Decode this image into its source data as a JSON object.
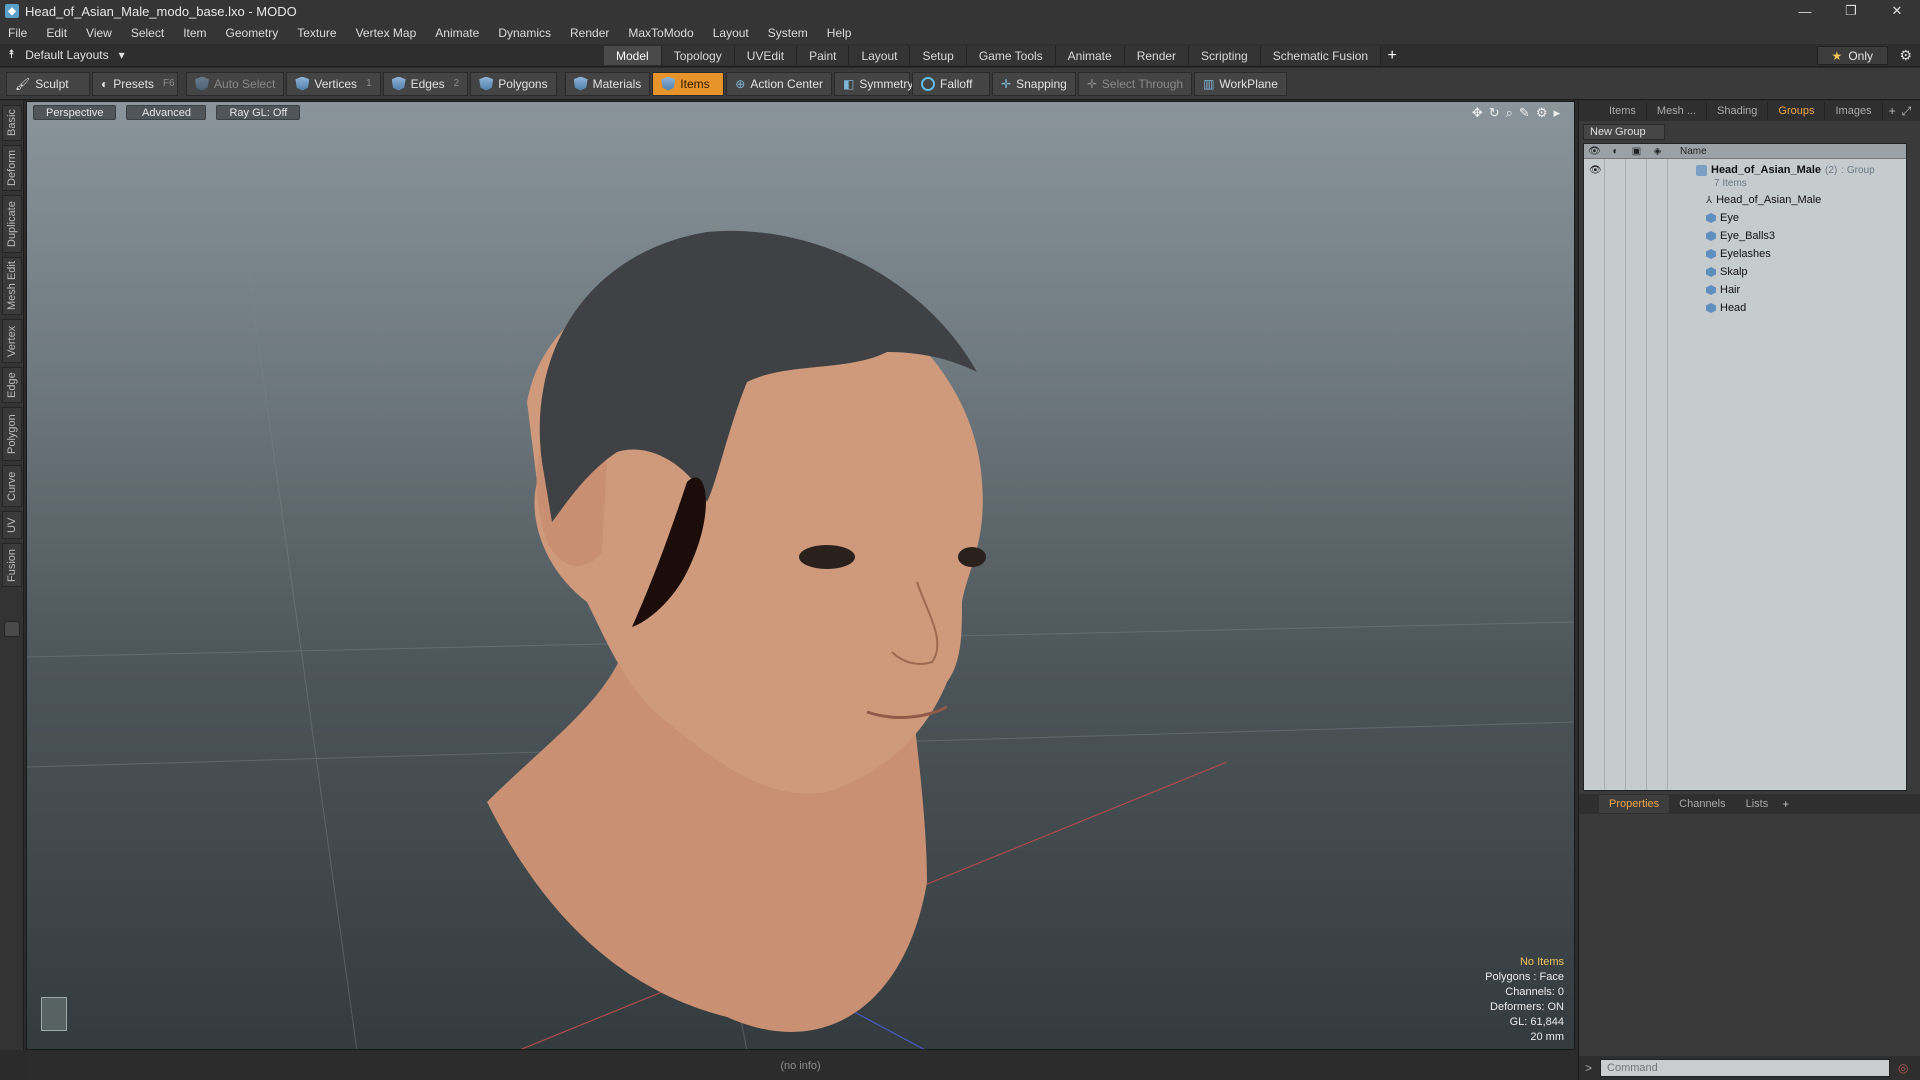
{
  "window": {
    "title": "Head_of_Asian_Male_modo_base.lxo - MODO",
    "controls": [
      "—",
      "❐",
      "✕"
    ]
  },
  "menu": [
    "File",
    "Edit",
    "View",
    "Select",
    "Item",
    "Geometry",
    "Texture",
    "Vertex Map",
    "Animate",
    "Dynamics",
    "Render",
    "MaxToModo",
    "Layout",
    "System",
    "Help"
  ],
  "layout_bar": {
    "layouts_label": "Default Layouts",
    "tabs": [
      "Model",
      "Topology",
      "UVEdit",
      "Paint",
      "Layout",
      "Setup",
      "Game Tools",
      "Animate",
      "Render",
      "Scripting",
      "Schematic Fusion"
    ],
    "active_tab": "Model",
    "only_label": "Only"
  },
  "toolbar": {
    "sculpt": "Sculpt",
    "presets": "Presets",
    "presets_key": "F6",
    "auto_select": "Auto Select",
    "vertices": "Vertices",
    "vertices_key": "1",
    "edges": "Edges",
    "edges_key": "2",
    "polygons": "Polygons",
    "materials": "Materials",
    "items": "Items",
    "action_center": "Action Center",
    "symmetry": "Symmetry",
    "falloff": "Falloff",
    "snapping": "Snapping",
    "select_through": "Select Through",
    "workplane": "WorkPlane"
  },
  "left_tabs": [
    "Basic",
    "Deform",
    "Duplicate",
    "Mesh Edit",
    "Vertex",
    "Edge",
    "Polygon",
    "Curve",
    "UV",
    "Fusion"
  ],
  "viewport": {
    "view_mode": "Perspective",
    "shading": "Advanced",
    "raygl": "Ray GL: Off",
    "info": {
      "items": "No Items",
      "polygons": "Polygons : Face",
      "channels": "Channels: 0",
      "deformers": "Deformers: ON",
      "gl": "GL: 61,844",
      "scale": "20 mm"
    }
  },
  "status_bar": "(no info)",
  "right_panel": {
    "tabs": [
      "Items",
      "Mesh ...",
      "Shading",
      "Groups",
      "Images"
    ],
    "active_tab": "Groups",
    "new_group": "New Group",
    "column_name": "Name",
    "group_name": "Head_of_Asian_Male",
    "group_count": "(2)",
    "group_type": ": Group",
    "group_items": "7 Items",
    "children": [
      "Head_of_Asian_Male",
      "Eye",
      "Eye_Balls3",
      "Eyelashes",
      "Skalp",
      "Hair",
      "Head"
    ],
    "lower_tabs": [
      "Properties",
      "Channels",
      "Lists"
    ],
    "lower_active": "Properties",
    "command_placeholder": "Command"
  },
  "colors": {
    "accent": "#e8942a",
    "active_tab_text": "#f0a545",
    "info_highlight": "#f2c45a"
  }
}
